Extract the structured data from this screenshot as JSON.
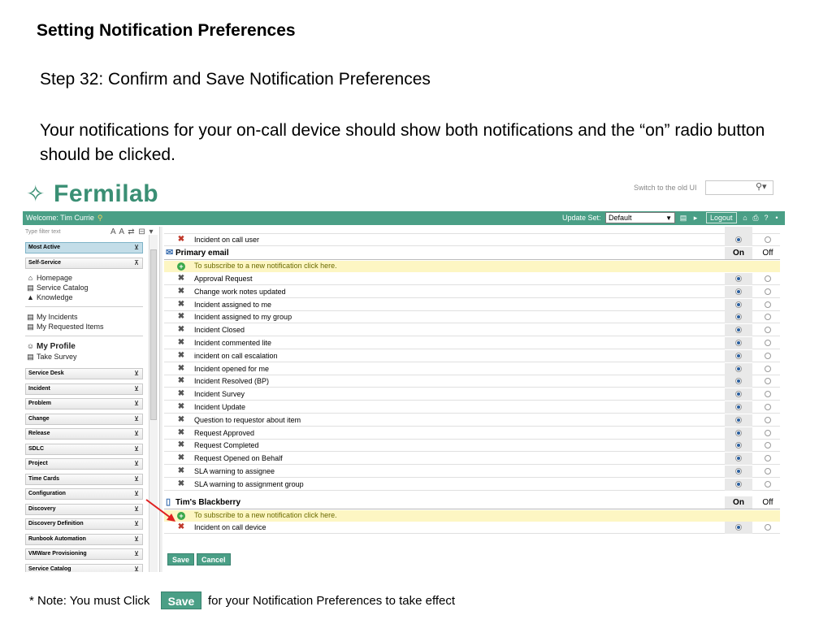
{
  "slide": {
    "title": "Setting Notification Preferences",
    "step": "Step 32: Confirm and Save Notification Preferences",
    "description": "Your notifications for your on-call device should show both notifications and the “on” radio button should be clicked."
  },
  "header": {
    "logo_text": "Fermilab",
    "switch_ui": "Switch to the old UI",
    "search_value": ""
  },
  "nav_bar": {
    "welcome": "Welcome: Tim Currie",
    "update_set_label": "Update Set:",
    "update_set_value": "Default",
    "logout_label": "Logout"
  },
  "left_nav": {
    "filter_placeholder": "Type filter text",
    "filter_tools": "A A ⇄ ⊟ ▾",
    "sections_top": [
      {
        "label": "Most Active"
      },
      {
        "label": "Self-Service"
      }
    ],
    "self_service_links": [
      {
        "label": "Homepage",
        "icon": "home-icon"
      },
      {
        "label": "Service Catalog",
        "icon": "catalog-icon"
      },
      {
        "label": "Knowledge",
        "icon": "knowledge-icon"
      }
    ],
    "incident_links": [
      {
        "label": "My Incidents",
        "icon": "incidents-icon"
      },
      {
        "label": "My Requested Items",
        "icon": "requested-items-icon"
      }
    ],
    "profile_links": [
      {
        "label": "My Profile",
        "icon": "profile-icon"
      },
      {
        "label": "Take Survey",
        "icon": "survey-icon"
      }
    ],
    "sections": [
      {
        "label": "Service Desk"
      },
      {
        "label": "Incident"
      },
      {
        "label": "Problem"
      },
      {
        "label": "Change"
      },
      {
        "label": "Release"
      },
      {
        "label": "SDLC"
      },
      {
        "label": "Project"
      },
      {
        "label": "Time Cards"
      },
      {
        "label": "Configuration"
      },
      {
        "label": "Discovery"
      },
      {
        "label": "Discovery Definition"
      },
      {
        "label": "Runbook Automation"
      },
      {
        "label": "VMWare Provisioning"
      },
      {
        "label": "Service Catalog"
      }
    ]
  },
  "notifications": {
    "top_row": {
      "label": "Incident on call user",
      "on": true
    },
    "primary_email": {
      "name": "Primary email",
      "col_on": "On",
      "col_off": "Off",
      "subscribe": "To subscribe to a new notification click here.",
      "items": [
        {
          "label": "Approval Request",
          "on": true
        },
        {
          "label": "Change work notes updated",
          "on": true
        },
        {
          "label": "Incident assigned to me",
          "on": true
        },
        {
          "label": "Incident assigned to my group",
          "on": true
        },
        {
          "label": "Incident Closed",
          "on": true
        },
        {
          "label": "Incident commented lite",
          "on": true
        },
        {
          "label": "incident on call escalation",
          "on": true
        },
        {
          "label": "Incident opened for me",
          "on": true
        },
        {
          "label": "Incident Resolved (BP)",
          "on": true
        },
        {
          "label": "Incident Survey",
          "on": true
        },
        {
          "label": "Incident Update",
          "on": true
        },
        {
          "label": "Question to requestor about item",
          "on": true
        },
        {
          "label": "Request Approved",
          "on": true
        },
        {
          "label": "Request Completed",
          "on": true
        },
        {
          "label": "Request Opened on Behalf",
          "on": true
        },
        {
          "label": "SLA warning to assignee",
          "on": true
        },
        {
          "label": "SLA warning to assignment group",
          "on": true
        }
      ]
    },
    "blackberry": {
      "name": "Tim's Blackberry",
      "col_on": "On",
      "col_off": "Off",
      "subscribe": "To subscribe to a new notification click here.",
      "items": [
        {
          "label": "Incident on call device",
          "on": true
        }
      ]
    }
  },
  "actions": {
    "save": "Save",
    "cancel": "Cancel"
  },
  "note": {
    "prefix": "* Note: You must Click",
    "button": "Save",
    "suffix": "for your Notification Preferences to take effect"
  },
  "colors": {
    "brand": "#3a8f74",
    "nav_bar": "#4a9f86",
    "subscribe_bg": "#fdf6c3",
    "remove_icon": "#c0392b",
    "arrow": "#e02020"
  }
}
